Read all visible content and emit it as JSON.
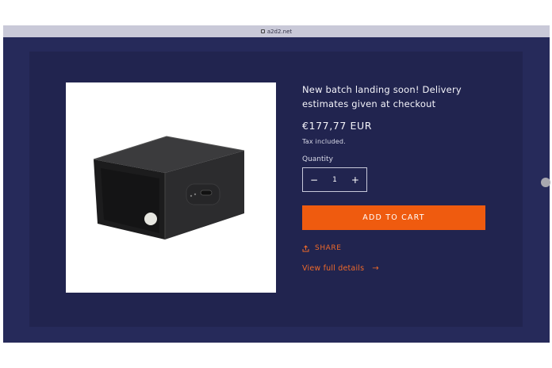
{
  "browser": {
    "url": "a2d2.net"
  },
  "product": {
    "headline": "New batch landing soon! Delivery estimates given at checkout",
    "price": "€177,77 EUR",
    "tax_note": "Tax included.",
    "quantity_label": "Quantity",
    "quantity_value": "1",
    "decrement_symbol": "−",
    "increment_symbol": "+",
    "add_to_cart_label": "ADD TO CART",
    "share_label": "SHARE",
    "details_label": "View full details",
    "details_arrow": "→"
  },
  "colors": {
    "page_background": "#262a5a",
    "panel_background": "#21244f",
    "accent": "#ef5b0f",
    "link": "#ef6a2a"
  },
  "icons": {
    "lock": "lock-icon",
    "share": "share-icon",
    "arrow": "arrow-right-icon"
  }
}
